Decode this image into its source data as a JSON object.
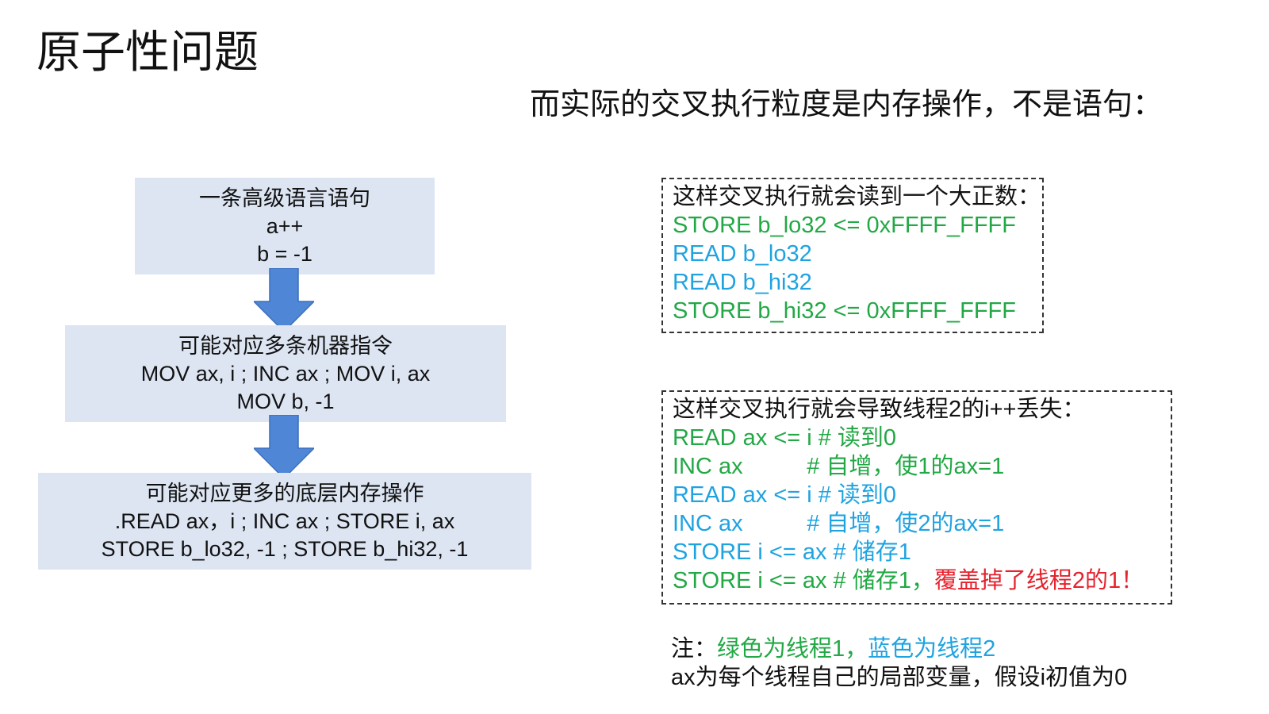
{
  "slide": {
    "title": "原子性问题",
    "subtitle": "而实际的交叉执行粒度是内存操作，不是语句："
  },
  "flow": {
    "box1": [
      "一条高级语言语句",
      "a++",
      "b = -1"
    ],
    "box2": [
      "可能对应多条机器指令",
      "MOV ax, i ; INC ax ; MOV i, ax",
      "MOV b, -1"
    ],
    "box3": [
      "可能对应更多的底层内存操作",
      ".READ ax，i ; INC ax ; STORE i, ax",
      "STORE b_lo32, -1 ; STORE b_hi32, -1"
    ]
  },
  "example1": {
    "header": "这样交叉执行就会读到一个大正数：",
    "lines": [
      "STORE b_lo32 <= 0xFFFF_FFFF",
      "READ b_lo32",
      "READ b_hi32",
      "STORE b_hi32 <= 0xFFFF_FFFF"
    ]
  },
  "example2": {
    "header": "这样交叉执行就会导致线程2的i++丢失：",
    "lines": [
      "READ ax <= i # 读到0",
      "INC ax          # 自增，使1的ax=1",
      "READ ax <= i # 读到0",
      "INC ax          # 自增，使2的ax=1",
      "STORE i <= ax # 储存1",
      "STORE i <= ax # 储存1，"
    ],
    "warning": "覆盖掉了线程2的1！"
  },
  "note": {
    "prefix": "注：",
    "green_text": "绿色为线程1，",
    "blue_text": "蓝色为线程2",
    "line2": "ax为每个线程自己的局部变量，假设i初值为0"
  },
  "colors": {
    "thread1": "#22a845",
    "thread2": "#1fa3e0",
    "warning": "#e5222d",
    "box_fill": "#dde5f3",
    "arrow": "#4f86d6"
  }
}
